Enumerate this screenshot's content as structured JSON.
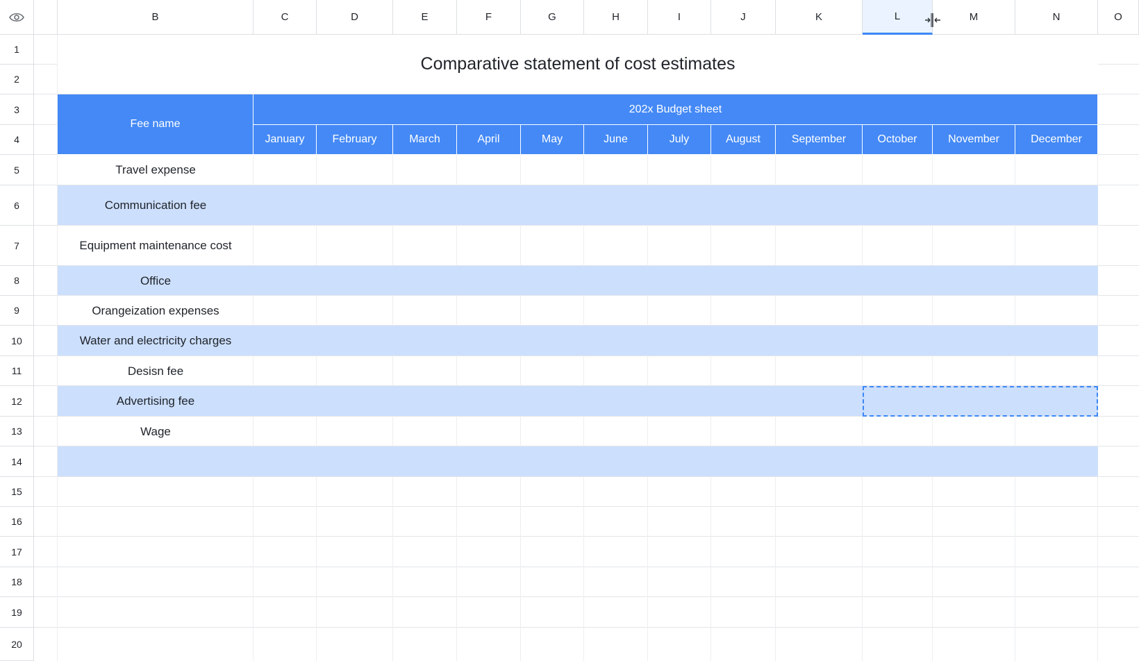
{
  "columns": [
    "B",
    "C",
    "D",
    "E",
    "F",
    "G",
    "H",
    "I",
    "J",
    "K",
    "L",
    "M",
    "N",
    "O"
  ],
  "active_column": "L",
  "rows": [
    "1",
    "2",
    "3",
    "4",
    "5",
    "6",
    "7",
    "8",
    "9",
    "10",
    "11",
    "12",
    "13",
    "14",
    "15",
    "16",
    "17",
    "18",
    "19",
    "20"
  ],
  "title": "Comparative statement of cost estimates",
  "header": {
    "fee_name": "Fee name",
    "budget": "202x Budget sheet",
    "months": [
      "January",
      "February",
      "March",
      "April",
      "May",
      "June",
      "July",
      "August",
      "September",
      "October",
      "November",
      "December"
    ]
  },
  "fees": [
    "Travel expense",
    "Communication fee",
    "Equipment maintenance cost",
    "Office",
    "Orangeization expenses",
    "Water and electricity charges",
    "Desisn fee",
    "Advertising fee",
    "Wage",
    ""
  ],
  "colors": {
    "header_blue": "#4489f6",
    "band_blue": "#ccdffd",
    "accent": "#3b87f5"
  },
  "icons": {
    "corner": "eye-icon",
    "resize": "column-resize-icon"
  }
}
